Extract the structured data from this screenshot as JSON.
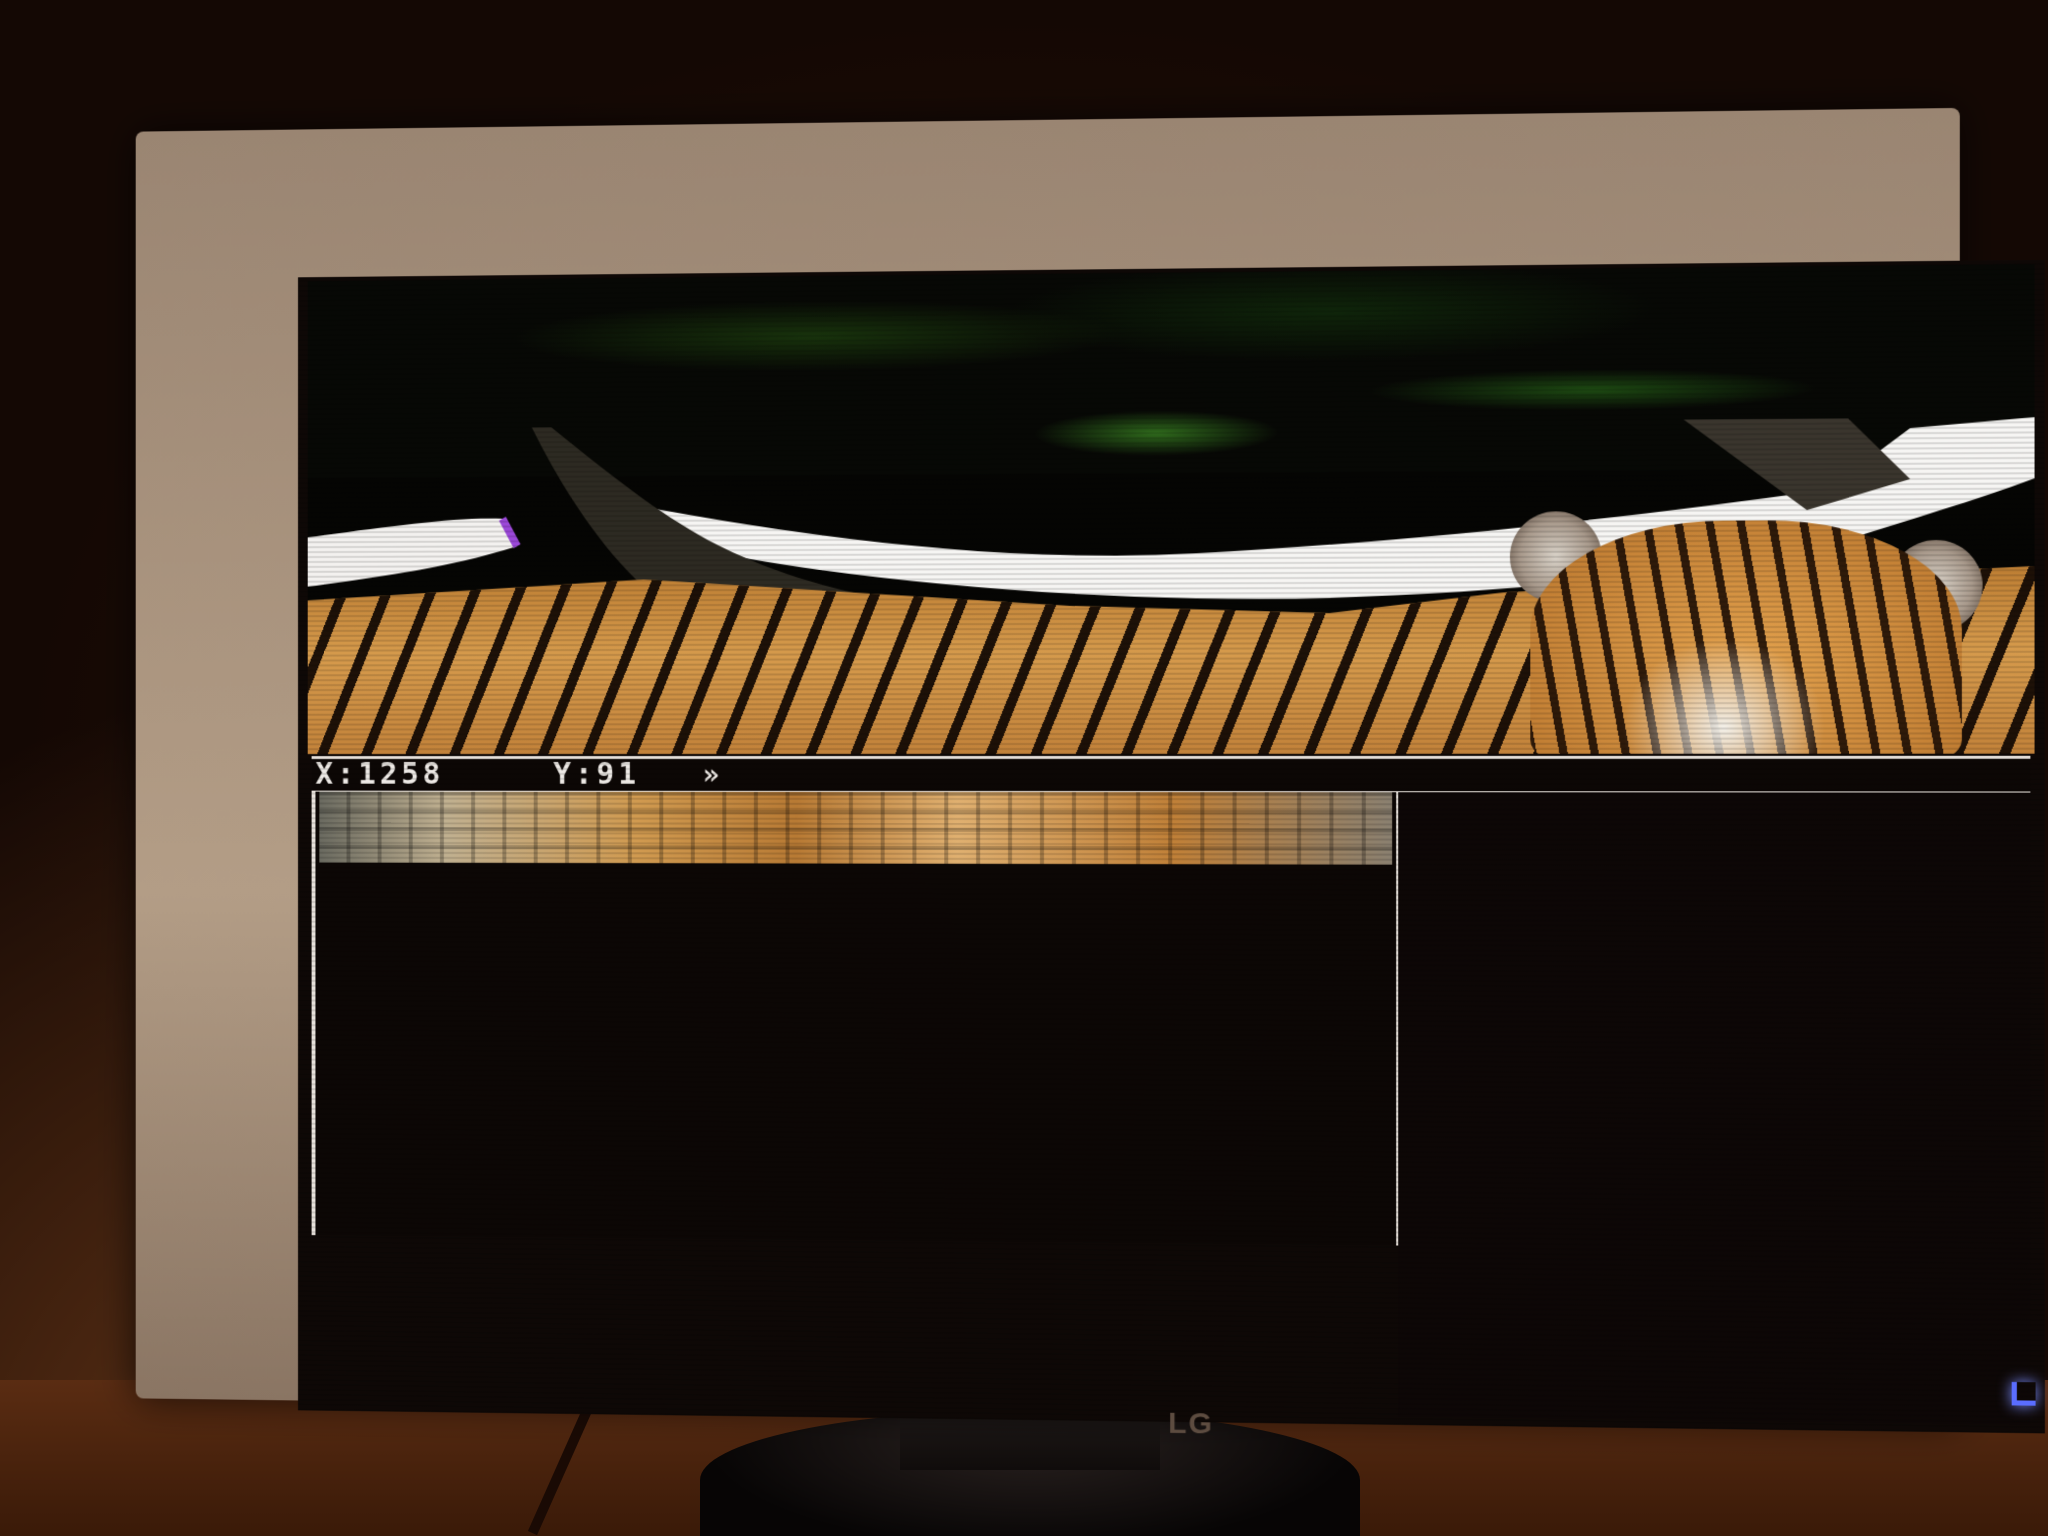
{
  "status_bar": {
    "x_readout": "X:1258",
    "y_readout": "Y:91",
    "arrow_glyph": "»"
  },
  "monitor": {
    "brand": "LG",
    "power_led_color": "#5a6dff"
  },
  "colors": {
    "ui_lines": "#e8e2dc",
    "screen_bg": "#0e0806"
  }
}
